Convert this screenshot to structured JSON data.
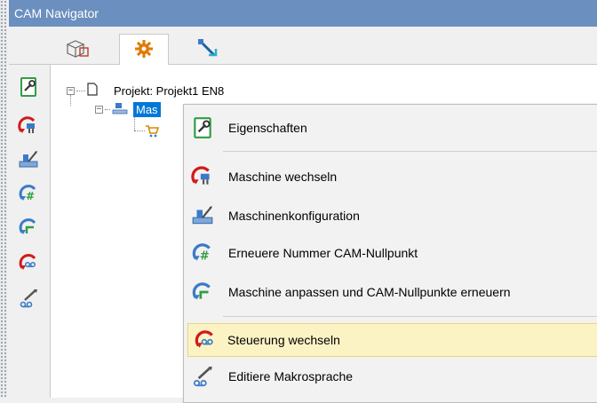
{
  "window": {
    "title": "CAM Navigator"
  },
  "tabs": [
    {
      "icon": "part-cube-icon"
    },
    {
      "icon": "gear-icon",
      "active": true
    },
    {
      "icon": "tool-path-icon"
    }
  ],
  "toolbar": [
    {
      "icon": "properties-icon"
    },
    {
      "icon": "change-machine-icon"
    },
    {
      "icon": "machine-config-icon"
    },
    {
      "icon": "renumber-zero-icon"
    },
    {
      "icon": "adapt-machine-icon"
    },
    {
      "icon": "change-control-icon"
    },
    {
      "icon": "edit-macro-icon"
    }
  ],
  "tree": {
    "root": {
      "label": "Projekt: Projekt1 EN8",
      "expander": "−"
    },
    "machine": {
      "label": "Mas",
      "expander": "−"
    }
  },
  "context_menu": {
    "items": [
      {
        "label": "Eigenschaften",
        "icon": "properties-icon"
      },
      {
        "label": "Maschine wechseln",
        "icon": "change-machine-icon"
      },
      {
        "label": "Maschinenkonfiguration",
        "icon": "machine-config-icon"
      },
      {
        "label": "Erneuere Nummer CAM-Nullpunkt",
        "icon": "renumber-zero-icon"
      },
      {
        "label": "Maschine anpassen und CAM-Nullpunkte erneuern",
        "icon": "adapt-machine-icon"
      },
      {
        "label": "Steuerung wechseln",
        "icon": "change-control-icon",
        "highlighted": true
      },
      {
        "label": "Editiere Makrosprache",
        "icon": "edit-macro-icon"
      }
    ]
  },
  "colors": {
    "titlebar": "#6b8fbe",
    "selection": "#0078d7",
    "highlight": "#fcf3c5",
    "red_arrow": "#d21a1a",
    "green": "#2f9e44",
    "blue": "#3b7ac9"
  }
}
